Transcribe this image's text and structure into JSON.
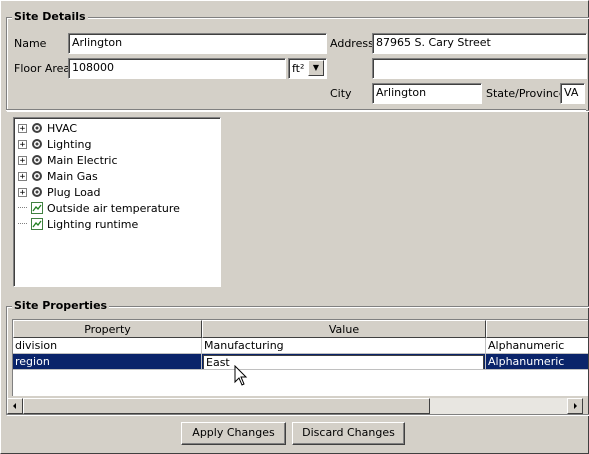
{
  "site_details": {
    "legend": "Site Details",
    "name_label": "Name",
    "name_value": "Arlington",
    "address_label": "Address",
    "address_line1": "87965 S. Cary Street",
    "address_line2": "",
    "floor_area_label": "Floor Area",
    "floor_area_value": "108000",
    "unit_value": "ft²",
    "city_label": "City",
    "city_value": "Arlington",
    "state_label": "State/Province",
    "state_value": "VA"
  },
  "tree": {
    "items": [
      {
        "label": "HVAC",
        "icon": "gear-icon",
        "expandable": true
      },
      {
        "label": "Lighting",
        "icon": "gear-icon",
        "expandable": true
      },
      {
        "label": "Main Electric",
        "icon": "gear-icon",
        "expandable": true
      },
      {
        "label": "Main Gas",
        "icon": "gear-icon",
        "expandable": true
      },
      {
        "label": "Plug Load",
        "icon": "gear-icon",
        "expandable": true
      },
      {
        "label": "Outside air temperature",
        "icon": "chart-icon",
        "expandable": false
      },
      {
        "label": "Lighting runtime",
        "icon": "chart-icon",
        "expandable": false
      }
    ]
  },
  "site_properties": {
    "legend": "Site Properties",
    "columns": [
      "Property",
      "Value",
      ""
    ],
    "rows": [
      {
        "property": "division",
        "value": "Manufacturing",
        "type": "Alphanumeric",
        "selected": false
      },
      {
        "property": "region",
        "value": "East",
        "type": "Alphanumeric",
        "selected": true
      }
    ]
  },
  "buttons": {
    "apply": "Apply Changes",
    "discard": "Discard Changes"
  },
  "colors": {
    "window_bg": "#d4d0c8",
    "selection": "#0a246a"
  }
}
